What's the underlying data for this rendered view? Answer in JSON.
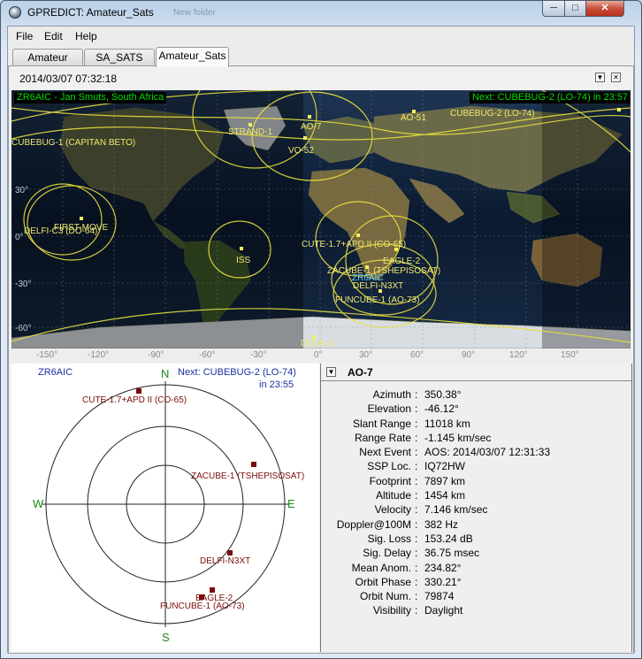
{
  "window": {
    "title": "GPREDICT: Amateur_Sats",
    "ghost_title": "New folder",
    "minimize": "─",
    "maximize": "□",
    "close": "✕"
  },
  "menu": [
    "File",
    "Edit",
    "Help"
  ],
  "tabs": [
    "Amateur",
    "SA_SATS",
    "Amateur_Sats"
  ],
  "module": {
    "timestamp": "2014/03/07 07:32:18",
    "down_btn": "▼",
    "close_btn": "✕"
  },
  "map": {
    "station": "ZR6AIC - Jan Smuts, South Africa",
    "next_event": "Next: CUBEBUG-2 (LO-74) in 23:57",
    "lat_labels": [
      "30°",
      "0°",
      "-30°",
      "-60°"
    ],
    "lon_labels": [
      "-150°",
      "-120°",
      "-90°",
      "-60°",
      "-30°",
      "0°",
      "30°",
      "60°",
      "90°",
      "120°",
      "150°"
    ],
    "satellites": [
      {
        "name": "AO-7"
      },
      {
        "name": "AO-51"
      },
      {
        "name": "CUBEBUG-2 (LO-74)"
      },
      {
        "name": "CUBEBUG-1 (CAPITAN BETO)"
      },
      {
        "name": "STRAND-1"
      },
      {
        "name": "VO-52"
      },
      {
        "name": "FIRST-MOVE"
      },
      {
        "name": "DELFI-C3 (DO-64)"
      },
      {
        "name": "ISS"
      },
      {
        "name": "CUTE-1.7+APD II (CO-65)"
      },
      {
        "name": "EAGLE-2"
      },
      {
        "name": "ZACUBE-1 (TSHEPISOSAT)"
      },
      {
        "name": "DELFI-N3XT"
      },
      {
        "name": "FUNCUBE-1 (AO-73)"
      },
      {
        "name": "DOVE-3"
      }
    ],
    "station_marker": "ZR6AIC"
  },
  "polar": {
    "station": "ZR6AIC",
    "next_line1": "Next: CUBEBUG-2 (LO-74)",
    "next_line2": "in 23:55",
    "dirs": {
      "n": "N",
      "s": "S",
      "e": "E",
      "w": "W"
    },
    "sats": [
      {
        "name": "CUTE-1.7+APD II (CO-65)"
      },
      {
        "name": "ZACUBE-1 (TSHEPISOSAT)"
      },
      {
        "name": "DELFI-N3XT"
      },
      {
        "name": "EAGLE-2"
      },
      {
        "name": "FUNCUBE-1 (AO-73)"
      }
    ]
  },
  "info": {
    "satellite": "AO-7",
    "rows": [
      {
        "label": "Azimuth",
        "value": "350.38°"
      },
      {
        "label": "Elevation",
        "value": "-46.12°"
      },
      {
        "label": "Slant Range",
        "value": "11018 km"
      },
      {
        "label": "Range Rate",
        "value": "-1.145 km/sec"
      },
      {
        "label": "Next Event",
        "value": "AOS: 2014/03/07 12:31:33"
      },
      {
        "label": "SSP Loc.",
        "value": "IQ72HW"
      },
      {
        "label": "Footprint",
        "value": "7897 km"
      },
      {
        "label": "Altitude",
        "value": "1454 km"
      },
      {
        "label": "Velocity",
        "value": "7.146 km/sec"
      },
      {
        "label": "Doppler@100M",
        "value": "382 Hz"
      },
      {
        "label": "Sig. Loss",
        "value": "153.24 dB"
      },
      {
        "label": "Sig. Delay",
        "value": "36.75 msec"
      },
      {
        "label": "Mean Anom.",
        "value": "234.82°"
      },
      {
        "label": "Orbit Phase",
        "value": "330.21°"
      },
      {
        "label": "Orbit Num.",
        "value": "79874"
      },
      {
        "label": "Visibility",
        "value": "Daylight"
      }
    ]
  },
  "colors": {
    "footprint": "#e8e040",
    "marker": "#f5f060",
    "polar_marker": "#7a0c0c",
    "station": "#00e000"
  }
}
